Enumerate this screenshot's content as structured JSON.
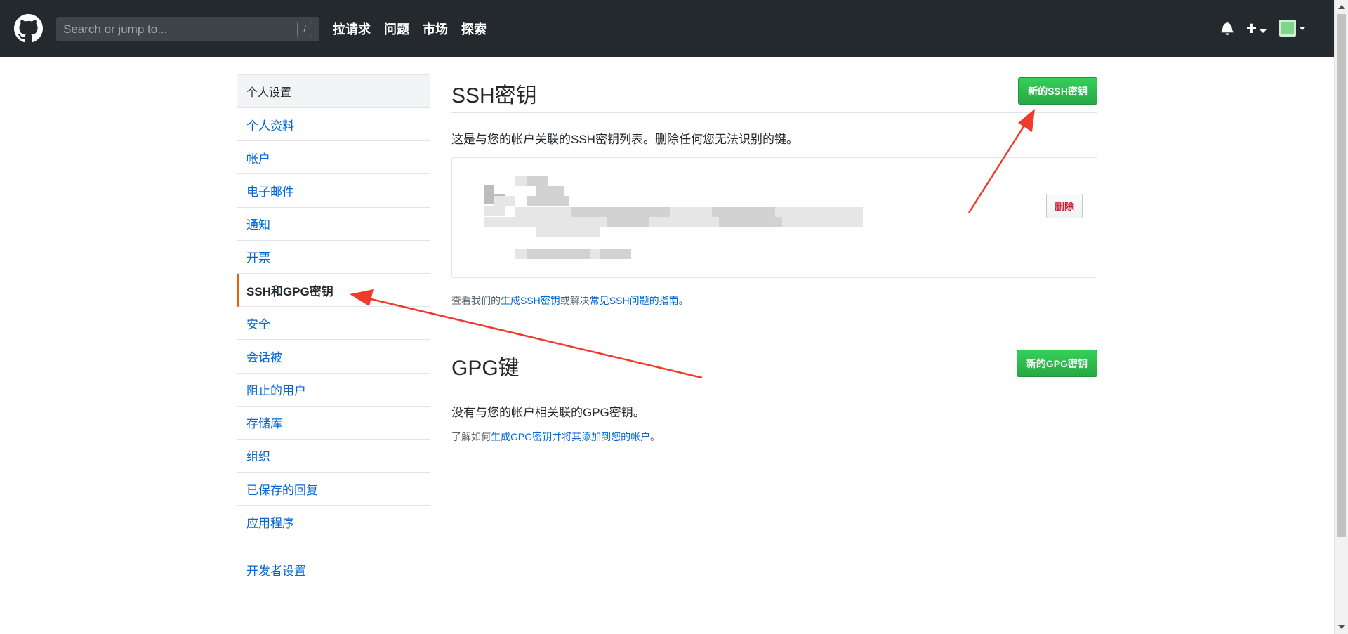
{
  "header": {
    "search_placeholder": "Search or jump to...",
    "search_shortcut": "/",
    "nav": [
      "拉请求",
      "问题",
      "市场",
      "探索"
    ],
    "plus_label": "+"
  },
  "sidebar": {
    "heading": "个人设置",
    "items": [
      "个人资料",
      "帐户",
      "电子邮件",
      "通知",
      "开票",
      "SSH和GPG密钥",
      "安全",
      "会话被",
      "阻止的用户",
      "存储库",
      "组织",
      "已保存的回复",
      "应用程序"
    ],
    "selected_index": 5,
    "developer_settings": "开发者设置"
  },
  "ssh": {
    "title": "SSH密钥",
    "new_button": "新的SSH密钥",
    "description": "这是与您的帐户关联的SSH密钥列表。删除任何您无法识别的键。",
    "delete_button": "删除",
    "help_prefix": "查看我们的",
    "help_link1": "生成SSH密钥",
    "help_middle": "或解决",
    "help_link2": "常见SSH问题的指南",
    "help_suffix": "。"
  },
  "gpg": {
    "title": "GPG键",
    "new_button": "新的GPG密钥",
    "description": "没有与您的帐户相关联的GPG密钥。",
    "help_prefix": "了解如何",
    "help_link": "生成GPG密钥并将其添加到您的帐户",
    "help_suffix": "。"
  },
  "colors": {
    "header_bg": "#24292e",
    "link": "#0366d6",
    "primary_button": "#28a745",
    "danger_text": "#cb2431",
    "selected_border": "#e36209",
    "annotation_arrow": "#f03a2b"
  }
}
